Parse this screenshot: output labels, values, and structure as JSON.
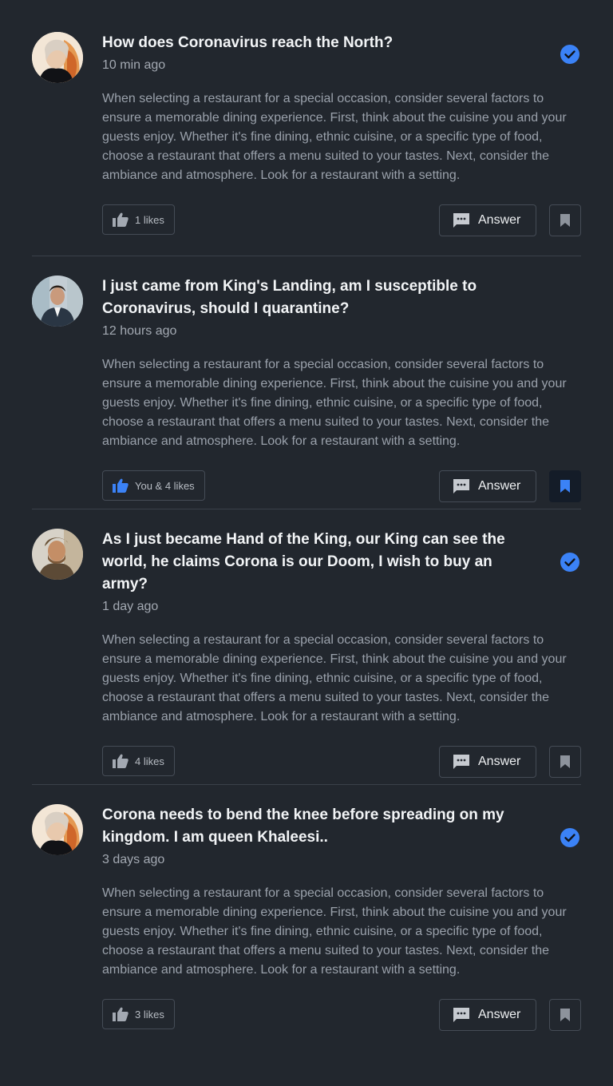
{
  "colors": {
    "background": "#22272e",
    "accent": "#3b82f6",
    "verified": "#3b82f6"
  },
  "questions": [
    {
      "title": "How does Coronavirus reach the North?",
      "time": "10 min ago",
      "verified": true,
      "avatar": "woman-portrait",
      "body": "When selecting a restaurant for a special occasion, consider several factors to ensure a memorable dining experience. First, think about the cuisine you and your guests enjoy. Whether it's fine dining, ethnic cuisine, or a specific type of food, choose a restaurant that offers a menu suited to your tastes. Next, consider the ambiance and atmosphere. Look for a restaurant with a setting.",
      "likes_label": "1 likes",
      "liked": false,
      "answer_label": "Answer",
      "bookmarked": false
    },
    {
      "title": "I just came from King's Landing, am I susceptible to Coronavirus, should I quarantine?",
      "time": "12 hours ago",
      "verified": false,
      "avatar": "man-suit-portrait",
      "body": "When selecting a restaurant for a special occasion, consider several factors to ensure a memorable dining experience. First, think about the cuisine you and your guests enjoy. Whether it's fine dining, ethnic cuisine, or a specific type of food, choose a restaurant that offers a menu suited to your tastes. Next, consider the ambiance and atmosphere. Look for a restaurant with a setting.",
      "likes_label": "You & 4 likes",
      "liked": true,
      "answer_label": "Answer",
      "bookmarked": true
    },
    {
      "title": "As I just became Hand of the King, our King can see the world, he claims Corona is our Doom, I wish to buy an army?",
      "time": "1 day ago",
      "verified": true,
      "avatar": "man-beard-portrait",
      "body": "When selecting a restaurant for a special occasion, consider several factors to ensure a memorable dining experience. First, think about the cuisine you and your guests enjoy. Whether it's fine dining, ethnic cuisine, or a specific type of food, choose a restaurant that offers a menu suited to your tastes. Next, consider the ambiance and atmosphere. Look for a restaurant with a setting.",
      "likes_label": "4 likes",
      "liked": false,
      "answer_label": "Answer",
      "bookmarked": false
    },
    {
      "title": "Corona needs to bend the knee before spreading on my kingdom. I am queen Khaleesi..",
      "time": "3 days ago",
      "verified": true,
      "avatar": "woman-portrait",
      "body": "When selecting a restaurant for a special occasion, consider several factors to ensure a memorable dining experience. First, think about the cuisine you and your guests enjoy. Whether it's fine dining, ethnic cuisine, or a specific type of food, choose a restaurant that offers a menu suited to your tastes. Next, consider the ambiance and atmosphere. Look for a restaurant with a setting.",
      "likes_label": "3 likes",
      "liked": false,
      "answer_label": "Answer",
      "bookmarked": false
    }
  ]
}
